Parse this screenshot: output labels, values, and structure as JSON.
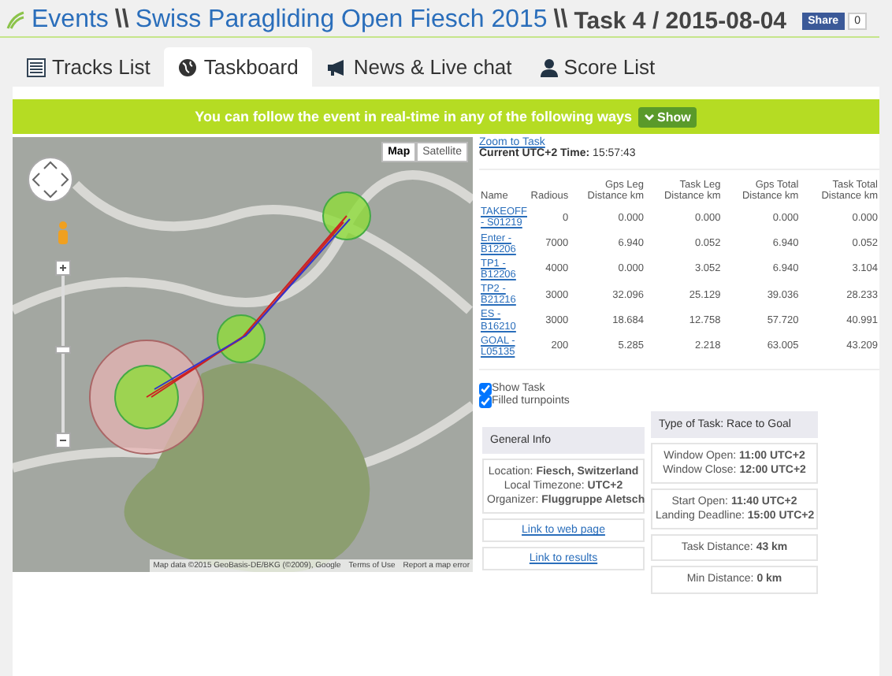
{
  "breadcrumb": {
    "links": [
      "Events",
      "Swiss Paragliding Open Fiesch 2015"
    ],
    "separators": [
      "\\\\",
      "\\\\"
    ],
    "current": "Task 4 / 2015-08-04"
  },
  "share": {
    "label": "Share",
    "count": "0"
  },
  "tabs": [
    {
      "label": "Tracks List",
      "kind": "list",
      "selected": false
    },
    {
      "label": "Taskboard",
      "kind": "globe",
      "selected": true
    },
    {
      "label": "News & Live chat",
      "kind": "megaphone",
      "selected": false
    },
    {
      "label": "Score List",
      "kind": "user",
      "selected": false
    }
  ],
  "banner": {
    "text": "You can follow the event in real-time in any of the following ways",
    "button": "Show"
  },
  "map": {
    "types": [
      {
        "label": "Map",
        "selected": true
      },
      {
        "label": "Satellite",
        "selected": false
      }
    ],
    "attribution": "Map data ©2015 GeoBasis-DE/BKG (©2009), Google",
    "terms": "Terms of Use",
    "report": "Report a map error"
  },
  "zoom_link": "Zoom to Task",
  "time": {
    "label": "Current UTC+2 Time:",
    "value": "15:57:43"
  },
  "table": {
    "columns": [
      "Name",
      "Radious",
      "Gps Leg Distance km",
      "Task Leg Distance km",
      "Gps Total Distance km",
      "Task Total Distance km"
    ],
    "rows": [
      [
        "TAKEOFF - S01219",
        "0",
        "0.000",
        "0.000",
        "0.000",
        "0.000"
      ],
      [
        "Enter - B12206",
        "7000",
        "6.940",
        "0.052",
        "6.940",
        "0.052"
      ],
      [
        "TP1 - B12206",
        "4000",
        "0.000",
        "3.052",
        "6.940",
        "3.104"
      ],
      [
        "TP2 - B21216",
        "3000",
        "32.096",
        "25.129",
        "39.036",
        "28.233"
      ],
      [
        "ES - B16210",
        "3000",
        "18.684",
        "12.758",
        "57.720",
        "40.991"
      ],
      [
        "GOAL - L05135",
        "200",
        "5.285",
        "2.218",
        "63.005",
        "43.209"
      ]
    ]
  },
  "options": [
    {
      "label": "Show Task",
      "checked": true
    },
    {
      "label": "Filled turnpoints",
      "checked": true
    }
  ],
  "general_info": {
    "title": "General Info",
    "lines": [
      {
        "label": "Location:",
        "value": "Fiesch, Switzerland"
      },
      {
        "label": "Local Timezone:",
        "value": "UTC+2"
      },
      {
        "label": "Organizer:",
        "value": "Fluggruppe Aletsch"
      }
    ],
    "links": [
      "Link to web page",
      "Link to results"
    ]
  },
  "task": {
    "title": "Type of Task: Race to Goal",
    "groups": [
      [
        {
          "label": "Window Open:",
          "value": "11:00 UTC+2"
        },
        {
          "label": "Window Close:",
          "value": "12:00 UTC+2"
        }
      ],
      [
        {
          "label": "Start Open:",
          "value": "11:40 UTC+2"
        },
        {
          "label": "Landing Deadline:",
          "value": "15:00 UTC+2"
        }
      ],
      [
        {
          "label": "Task Distance:",
          "value": "43 km"
        }
      ],
      [
        {
          "label": "Min Distance:",
          "value": "0 km"
        }
      ]
    ]
  }
}
